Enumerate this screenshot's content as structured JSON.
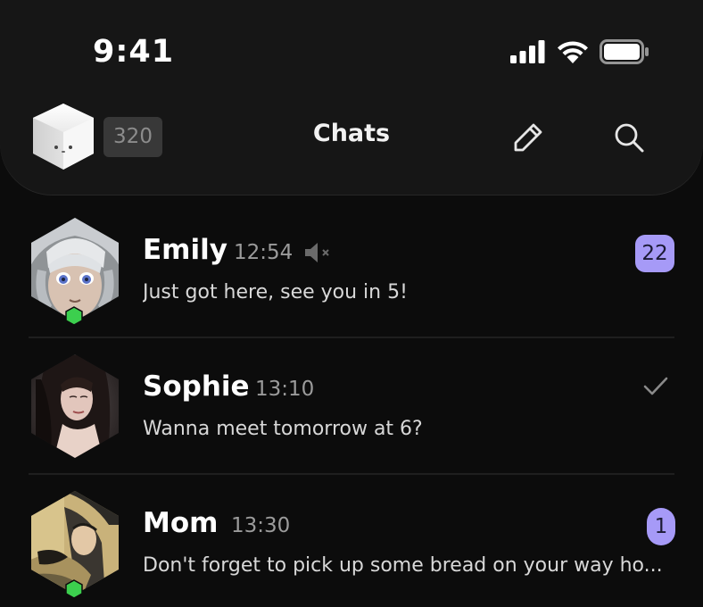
{
  "status_bar": {
    "time": "9:41",
    "signal_icon": "signal-bars-icon",
    "wifi_icon": "wifi-icon",
    "battery_icon": "battery-icon"
  },
  "header": {
    "profile_icon": "cube-avatar-icon",
    "coin_count": "320",
    "title": "Chats",
    "edit_icon": "pencil-icon",
    "search_icon": "search-icon"
  },
  "chats": [
    {
      "name": "Emily",
      "time": "12:54",
      "muted": true,
      "preview": "Just got here, see you in 5!",
      "unread": "22",
      "online": true,
      "avatar_desc": "anime-girl-avatar"
    },
    {
      "name": "Sophie",
      "time": "13:10",
      "muted": false,
      "preview": "Wanna meet tomorrow at 6?",
      "read_status": "check-icon",
      "online": false,
      "avatar_desc": "woman-portrait-avatar"
    },
    {
      "name": "Mom",
      "time": "13:30",
      "muted": false,
      "preview": "Don't forget to pick up some bread on your way ho...",
      "unread": "1",
      "online": true,
      "avatar_desc": "painting-avatar"
    }
  ],
  "colors": {
    "background": "#0c0c0c",
    "header_panel": "#161616",
    "accent_badge": "#a69af7",
    "online_green": "#3ccf4e",
    "muted_text": "#9b9b9b"
  }
}
